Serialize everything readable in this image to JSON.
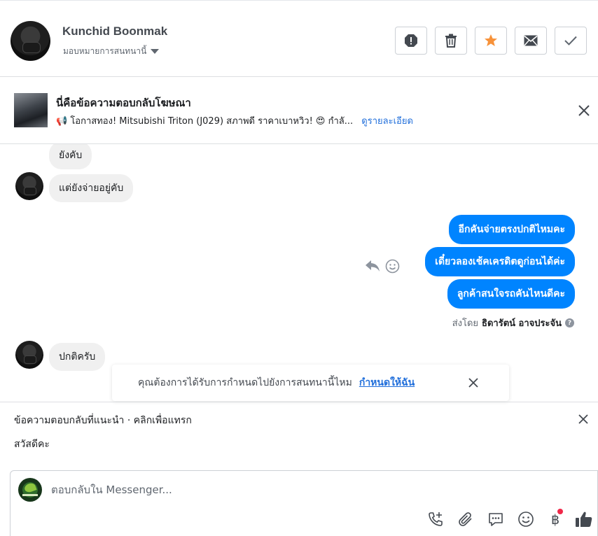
{
  "header": {
    "contact_name": "Kunchid Boonmak",
    "assign_label": "มอบหมายการสนทนานี้",
    "accent_color": "#f7923a"
  },
  "ad": {
    "title": "นี่คือข้อความตอบกลับโฆษณา",
    "emoji_left": "📢",
    "description": "โอกาสทอง! Mitsubishi Triton (J029) สภาพดี ราคาเบาหวิว! 😍 กำลั...",
    "details_link": "ดูรายละเอียด"
  },
  "messages": {
    "in_1": "ยังคับ",
    "in_2": "แต่ยังจ่ายอยู่คับ",
    "out_1": "อีกคันจ่ายตรงปกติไหมคะ",
    "out_2": "เดี๋ยวลองเช้คเครดิตดูก่อนได้ค่ะ",
    "out_3": "ลูกค้าสนใจรถคันไหนดีคะ",
    "sent_by_prefix": "ส่งโดย",
    "sent_by_name": "ธิดารัตน์ อาจประจัน",
    "in_3": "ปกติครับ"
  },
  "toast": {
    "text": "คุณต้องการได้รับการกำหนดไปยังการสนทนานี้ไหม",
    "link": "กำหนดให้ฉัน"
  },
  "suggestions": {
    "label": "ข้อความตอบกลับที่แนะนำ · คลิกเพื่อแทรก",
    "items": [
      "สวัสดีคะ"
    ]
  },
  "composer": {
    "placeholder": "ตอบกลับใน Messenger..."
  },
  "icons": [
    "report-icon",
    "trash-icon",
    "star-icon",
    "envelope-icon",
    "check-icon",
    "close-icon",
    "reply-icon",
    "emoji-icon",
    "phone-plus-icon",
    "paperclip-icon",
    "saved-replies-icon",
    "emoji-icon",
    "baht-icon",
    "like-icon"
  ]
}
